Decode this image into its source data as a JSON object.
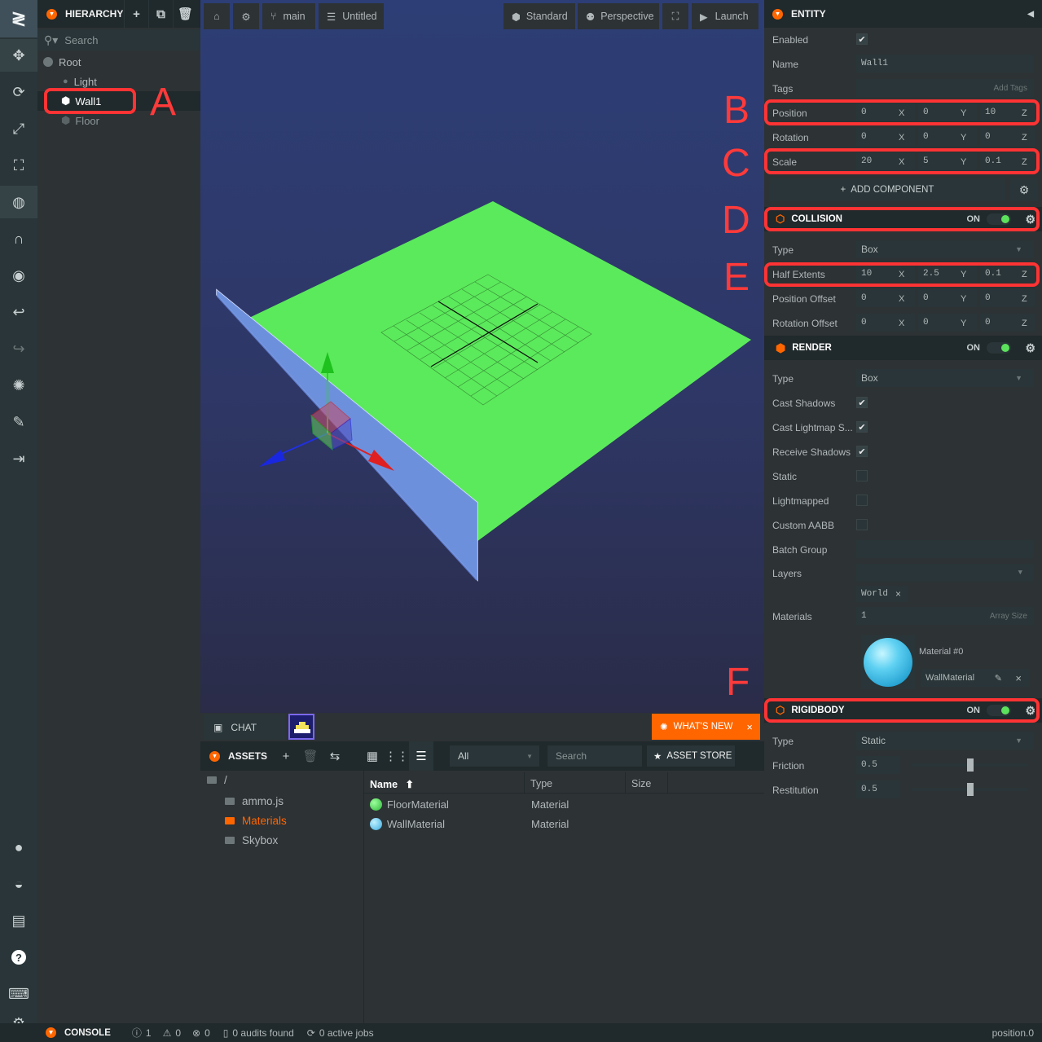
{
  "toolbar": {
    "logo": "≷",
    "tools": [
      "move-icon",
      "rotate-icon",
      "scale-icon",
      "resize-icon",
      "world-icon",
      "magnet-icon",
      "eye-icon",
      "undo-icon",
      "redo-icon",
      "light-icon",
      "edit-icon",
      "publish-icon"
    ],
    "bottom": [
      "github-icon",
      "discord-icon",
      "comment-icon",
      "help-icon",
      "keyboard-icon",
      "settings-icon"
    ]
  },
  "hierarchy": {
    "title": "HIERARCHY",
    "search_placeholder": "Search",
    "items": [
      {
        "label": "Root"
      },
      {
        "label": "Light"
      },
      {
        "label": "Wall1"
      },
      {
        "label": "Floor"
      }
    ]
  },
  "viewport": {
    "branch": "main",
    "scene": "Untitled",
    "render_mode": "Standard",
    "camera": "Perspective",
    "launch": "Launch"
  },
  "annotations": {
    "a": "A",
    "b": "B",
    "c": "C",
    "d": "D",
    "e": "E",
    "f": "F"
  },
  "chat": {
    "label": "CHAT"
  },
  "whats_new": {
    "label": "WHAT'S NEW"
  },
  "assets": {
    "title": "ASSETS",
    "filter": "All",
    "search_placeholder": "Search",
    "store": "ASSET STORE",
    "folders": [
      {
        "label": "/"
      },
      {
        "label": "ammo.js"
      },
      {
        "label": "Materials"
      },
      {
        "label": "Skybox"
      }
    ],
    "columns": {
      "name": "Name",
      "type": "Type",
      "size": "Size"
    },
    "rows": [
      {
        "name": "FloorMaterial",
        "type": "Material",
        "color": "#3fd24a"
      },
      {
        "name": "WallMaterial",
        "type": "Material",
        "color": "#4cc2f0"
      }
    ]
  },
  "entity": {
    "title": "ENTITY",
    "enabled_label": "Enabled",
    "name_label": "Name",
    "name_value": "Wall1",
    "tags_label": "Tags",
    "tags_button": "Add Tags",
    "position_label": "Position",
    "position": [
      "0",
      "0",
      "10"
    ],
    "rotation_label": "Rotation",
    "rotation": [
      "0",
      "0",
      "0"
    ],
    "scale_label": "Scale",
    "scale": [
      "20",
      "5",
      "0.1"
    ],
    "axes": [
      "X",
      "Y",
      "Z"
    ],
    "add_component": "ADD COMPONENT"
  },
  "collision": {
    "title": "COLLISION",
    "state": "ON",
    "type_label": "Type",
    "type_value": "Box",
    "half_extents_label": "Half Extents",
    "half_extents": [
      "10",
      "2.5",
      "0.1"
    ],
    "position_offset_label": "Position Offset",
    "position_offset": [
      "0",
      "0",
      "0"
    ],
    "rotation_offset_label": "Rotation Offset",
    "rotation_offset": [
      "0",
      "0",
      "0"
    ]
  },
  "render": {
    "title": "RENDER",
    "state": "ON",
    "type_label": "Type",
    "type_value": "Box",
    "cast_shadows": "Cast Shadows",
    "cast_lightmap": "Cast Lightmap S...",
    "receive_shadows": "Receive Shadows",
    "static": "Static",
    "lightmapped": "Lightmapped",
    "custom_aabb": "Custom AABB",
    "batch_group": "Batch Group",
    "layers": "Layers",
    "layer_tag": "World",
    "materials": "Materials",
    "materials_count": "1",
    "array_size": "Array Size",
    "material_slot": "Material #0",
    "material_name": "WallMaterial"
  },
  "rigidbody": {
    "title": "RIGIDBODY",
    "state": "ON",
    "type_label": "Type",
    "type_value": "Static",
    "friction_label": "Friction",
    "friction_value": "0.5",
    "friction": 0.5,
    "restitution_label": "Restitution",
    "restitution_value": "0.5",
    "restitution": 0.5
  },
  "status": {
    "console": "CONSOLE",
    "info": "1",
    "warnings": "0",
    "errors": "0",
    "audits": "0 audits found",
    "jobs": "0 active jobs",
    "position": "position.0"
  },
  "colors": {
    "accent": "#ff6600",
    "highlight": "#ff3333",
    "floor": "#5bea5b",
    "wall": "#6b8fdc"
  }
}
